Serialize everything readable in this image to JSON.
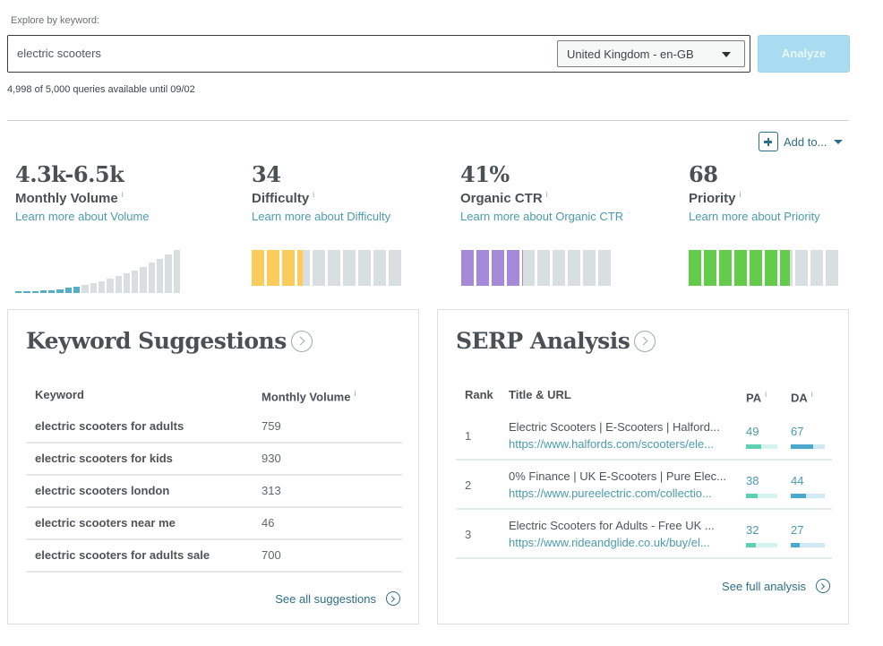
{
  "search": {
    "label": "Explore by keyword:",
    "query": "electric scooters",
    "locale": "United Kingdom - en-GB",
    "analyze_label": "Analyze",
    "quota_note": "4,998 of 5,000 queries available until 09/02"
  },
  "add_to": {
    "label": "Add to..."
  },
  "metrics": [
    {
      "value": "4.3k-6.5k",
      "name": "Monthly Volume",
      "info": "i",
      "learn": "Learn more about Volume",
      "color": "#53aec9"
    },
    {
      "value": "34",
      "name": "Difficulty",
      "info": "i",
      "learn": "Learn more about Difficulty",
      "color": "#fbcc5c",
      "score": 34
    },
    {
      "value": "41%",
      "name": "Organic CTR",
      "info": "i",
      "learn": "Learn more about Organic CTR",
      "color": "#a68ad9",
      "score": 41
    },
    {
      "value": "68",
      "name": "Priority",
      "info": "i",
      "learn": "Learn more about Priority",
      "color": "#64cc4b",
      "score": 68
    }
  ],
  "volume_histogram": {
    "bucket_count": 20,
    "active_buckets": 8
  },
  "keyword_suggestions": {
    "title": "Keyword Suggestions",
    "columns": [
      "Keyword",
      "Monthly Volume"
    ],
    "info": "i",
    "rows": [
      {
        "keyword": "electric scooters for adults",
        "volume": "759"
      },
      {
        "keyword": "electric scooters for kids",
        "volume": "930"
      },
      {
        "keyword": "electric scooters london",
        "volume": "313"
      },
      {
        "keyword": "electric scooters near me",
        "volume": "46"
      },
      {
        "keyword": "electric scooters for adults sale",
        "volume": "700"
      }
    ],
    "see_all": "See all suggestions"
  },
  "serp_analysis": {
    "title": "SERP Analysis",
    "columns": [
      "Rank",
      "Title & URL",
      "PA",
      "DA"
    ],
    "info": "i",
    "rows": [
      {
        "rank": "1",
        "title": "Electric Scooters | E-Scooters | Halford...",
        "url": "https://www.halfords.com/scooters/ele...",
        "pa": 49,
        "da": 67
      },
      {
        "rank": "2",
        "title": "0% Finance | UK E-Scooters | Pure Elec...",
        "url": "https://www.pureelectric.com/collectio...",
        "pa": 38,
        "da": 44
      },
      {
        "rank": "3",
        "title": "Electric Scooters for Adults - Free UK ...",
        "url": "https://www.rideandglide.co.uk/buy/el...",
        "pa": 32,
        "da": 27
      }
    ],
    "see_full": "See full analysis"
  }
}
